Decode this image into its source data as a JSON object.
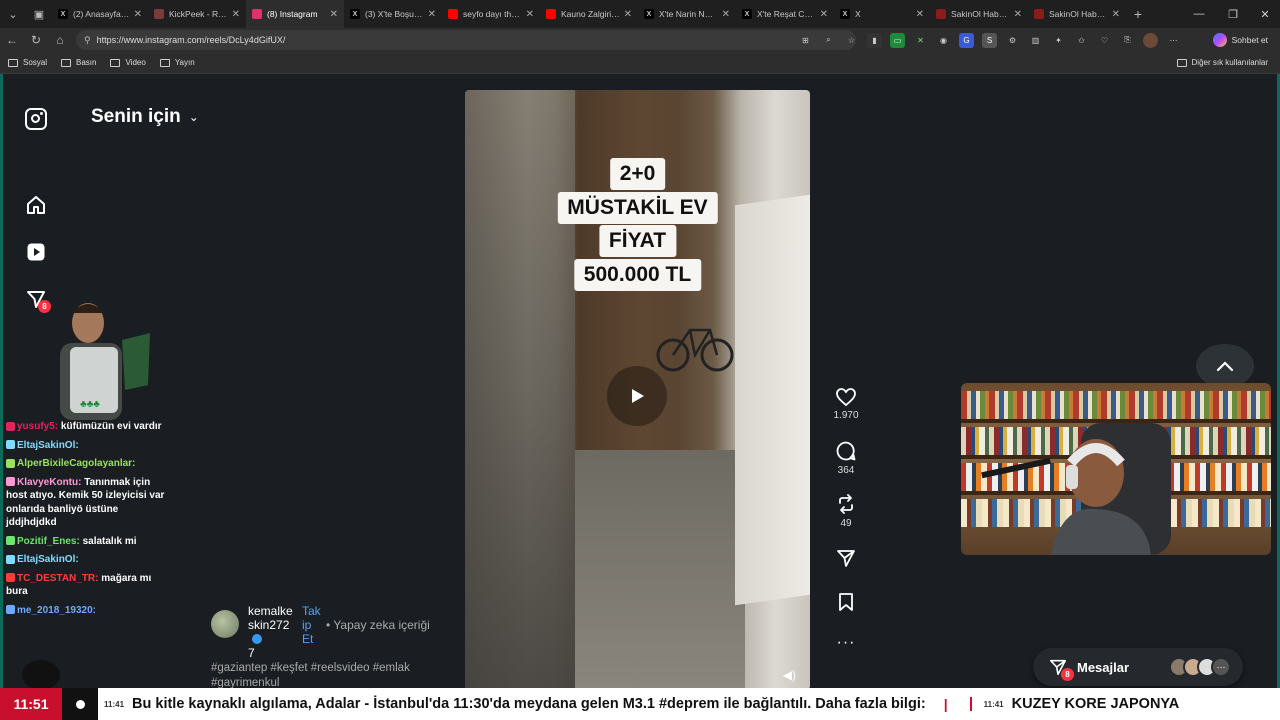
{
  "browser": {
    "tabs": [
      {
        "label": "(2) Anasayfa / X",
        "fav": "X",
        "fav_color": "#000000",
        "active": false
      },
      {
        "label": "KickPeek - Real-ti",
        "fav": "",
        "fav_color": "#7a3b3b",
        "active": false
      },
      {
        "label": "(8) Instagram",
        "fav": "",
        "fav_color": "#e1306c",
        "active": true
      },
      {
        "label": "(3) X'te Boşuna T",
        "fav": "X",
        "fav_color": "#000000",
        "active": false
      },
      {
        "label": "seyfo dayı theme",
        "fav": "",
        "fav_color": "#ff0000",
        "active": false
      },
      {
        "label": "Kauno Zalgiris'i k",
        "fav": "",
        "fav_color": "#ff0000",
        "active": false
      },
      {
        "label": "X'te Narin Nadirc",
        "fav": "X",
        "fav_color": "#000000",
        "active": false
      },
      {
        "label": "X'te Reşat Can Ö",
        "fav": "X",
        "fav_color": "#000000",
        "active": false
      },
      {
        "label": "X",
        "fav": "X",
        "fav_color": "#000000",
        "active": false
      },
      {
        "label": "SakinOl Haber M",
        "fav": "",
        "fav_color": "#8a1c1c",
        "active": false
      },
      {
        "label": "SakinOl Haber M",
        "fav": "",
        "fav_color": "#8a1c1c",
        "active": false
      }
    ],
    "url": "https://www.instagram.com/reels/DcLy4dGifUX/",
    "copilot_label": "Sohbet et",
    "bookmarks": [
      "Sosyal",
      "Basın",
      "Video",
      "Yayın"
    ],
    "other_bookmarks": "Diğer sık kullanılanlar"
  },
  "instagram": {
    "feed_title": "Senin için",
    "notification_count": "8",
    "overlay_lines": [
      "2+0",
      "MÜSTAKİL EV",
      "FİYAT",
      "500.000 TL"
    ],
    "likes": "1.970",
    "comments": "364",
    "reposts": "49",
    "author_name": "kemalkeskin2727",
    "author_line1": "kemalke",
    "author_line2": "skin272",
    "author_line3": "7",
    "follow_line1": "Tak",
    "follow_line2": "ip",
    "follow_line3": "Et",
    "ai_label": "• Yapay zeka içeriği",
    "hashtags": "#gaziantep #keşfet #reelsvideo #emlak #gayrimenkul",
    "messages_label": "Mesajlar",
    "messages_badge": "8"
  },
  "chat": [
    {
      "user": "yusufy5:",
      "text": "küfümüzün evi vardır",
      "color": "#e0245e"
    },
    {
      "user": "EltajSakinOl:",
      "text": "",
      "color": "#7fdcff"
    },
    {
      "user": "AlperBixileCagolayanlar:",
      "text": "",
      "color": "#9be15d"
    },
    {
      "user": "KlavyeKontu:",
      "text": "Tanınmak için host atıyo. Kemik 50 izleyicisi var onlarıda banliyö üstüne jddjhdjdkd",
      "color": "#ff9ad5"
    },
    {
      "user": "Pozitif_Enes:",
      "text": "salatalık mi",
      "color": "#6ee36e"
    },
    {
      "user": "EltajSakinOl:",
      "text": "",
      "color": "#7fdcff"
    },
    {
      "user": "TC_DESTAN_TR:",
      "text": "mağara mı bura",
      "color": "#ff3b3b"
    },
    {
      "user": "me_2018_19320:",
      "text": "",
      "color": "#6fa8ff"
    }
  ],
  "ticker": {
    "clock": "11:51",
    "item_time": "11:41",
    "item_text": "Bu kitle kaynaklı algılama, Adalar - İstanbul'da 11:30'da meydana gelen M3.1 #deprem ile bağlantılı. Daha fazla bilgi:",
    "item2_time": "11:41",
    "item2_text": "KUZEY KORE JAPONYA"
  },
  "colors": {
    "page_bg": "#1a1e22",
    "border_accent": "#0b6b5a",
    "ticker_red": "#c8102e",
    "link_blue": "#4fa3f7"
  }
}
